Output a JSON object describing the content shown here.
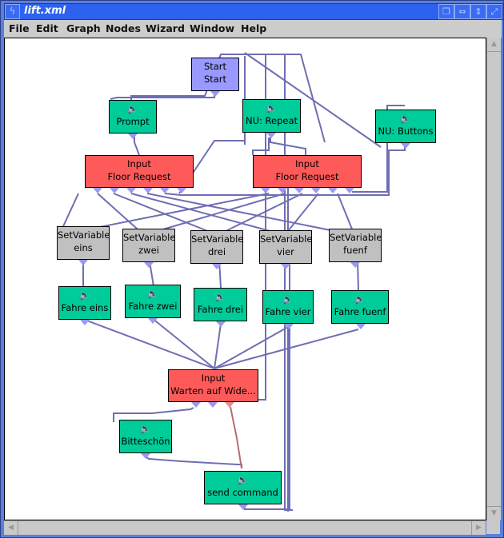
{
  "window": {
    "title": "lift.xml",
    "icon": "window-menu-icon",
    "controls": [
      "iconify-icon",
      "maximize-horizontal-icon",
      "maximize-vertical-icon",
      "maximize-icon"
    ]
  },
  "menubar": {
    "items": [
      "File",
      "Edit",
      "Graph",
      "Nodes",
      "Wizard",
      "Window",
      "Help"
    ]
  },
  "graph": {
    "nodes": [
      {
        "id": "start",
        "type": "start",
        "line1": "Start",
        "line2": "Start"
      },
      {
        "id": "prompt",
        "type": "audio",
        "icon": "speaker-icon",
        "label": "Prompt"
      },
      {
        "id": "nu_repeat",
        "type": "audio",
        "icon": "speaker-icon",
        "label": "NU: Repeat"
      },
      {
        "id": "nu_buttons",
        "type": "audio",
        "icon": "speaker-icon",
        "label": "NU: Buttons"
      },
      {
        "id": "input1",
        "type": "input",
        "line1": "Input",
        "line2": "Floor Request"
      },
      {
        "id": "input2",
        "type": "input",
        "line1": "Input",
        "line2": "Floor Request"
      },
      {
        "id": "sv_eins",
        "type": "setvar",
        "line1": "SetVariable",
        "line2": "eins"
      },
      {
        "id": "sv_zwei",
        "type": "setvar",
        "line1": "SetVariable",
        "line2": "zwei"
      },
      {
        "id": "sv_drei",
        "type": "setvar",
        "line1": "SetVariable",
        "line2": "drei"
      },
      {
        "id": "sv_vier",
        "type": "setvar",
        "line1": "SetVariable",
        "line2": "vier"
      },
      {
        "id": "sv_fuenf",
        "type": "setvar",
        "line1": "SetVariable",
        "line2": "fuenf"
      },
      {
        "id": "fahre_eins",
        "type": "audio",
        "icon": "speaker-icon",
        "label": "Fahre eins"
      },
      {
        "id": "fahre_zwei",
        "type": "audio",
        "icon": "speaker-icon",
        "label": "Fahre zwei"
      },
      {
        "id": "fahre_drei",
        "type": "audio",
        "icon": "speaker-icon",
        "label": "Fahre drei"
      },
      {
        "id": "fahre_vier",
        "type": "audio",
        "icon": "speaker-icon",
        "label": "Fahre vier"
      },
      {
        "id": "fahre_fuenf",
        "type": "audio",
        "icon": "speaker-icon",
        "label": "Fahre fuenf"
      },
      {
        "id": "input3",
        "type": "input",
        "line1": "Input",
        "line2": "Warten auf Wide..."
      },
      {
        "id": "bitteschoen",
        "type": "audio",
        "icon": "speaker-icon",
        "label": "Bitteschön"
      },
      {
        "id": "send_command",
        "type": "audio",
        "icon": "speaker-icon",
        "label": "send command"
      }
    ]
  },
  "colors": {
    "edge": "#6e6eb4",
    "edge_error": "#b46e6e",
    "start_node": "#9999ff",
    "audio_node": "#00cc99",
    "input_node": "#ff5a5a",
    "setvar_node": "#c0c0c0",
    "titlebar": "#2d62f0"
  },
  "scrollbars": {
    "vertical": {
      "up": "scroll-up-arrow",
      "down": "scroll-down-arrow"
    },
    "horizontal": {
      "left": "scroll-left-arrow",
      "right": "scroll-right-arrow"
    }
  }
}
